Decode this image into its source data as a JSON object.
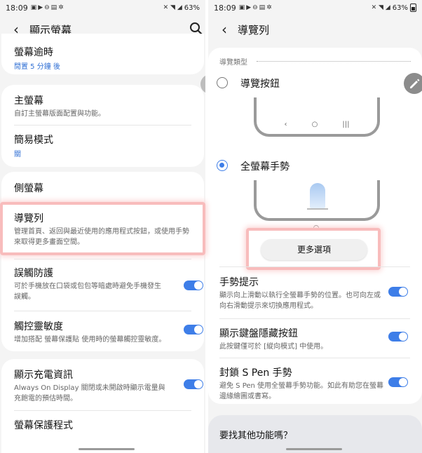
{
  "left": {
    "status": {
      "time": "18:09",
      "battery": "63%"
    },
    "title": "顯示螢幕",
    "items": {
      "screen_timeout": {
        "title": "螢幕逾時",
        "value": "閒置 5 分鐘 後"
      },
      "main_screen": {
        "title": "主螢幕",
        "desc": "自訂主螢幕版面配置與功能。"
      },
      "easy_mode": {
        "title": "簡易模式",
        "value": "關"
      },
      "edge_screen": {
        "title": "側螢幕"
      },
      "navigation_bar": {
        "title": "導覽列",
        "desc": "管理首頁、返回與最近使用的應用程式按鈕，或使用手勢來取得更多畫面空間。"
      },
      "accidental_touch": {
        "title": "誤觸防護",
        "desc": "可於手機放在口袋或包包等暗處時避免手機發生誤觸。",
        "enabled": true
      },
      "touch_sensitivity": {
        "title": "觸控靈敏度",
        "desc": "增加搭配 螢幕保護貼 使用時的螢幕觸控靈敏度。",
        "enabled": true
      },
      "charging_info": {
        "title": "顯示充電資訊",
        "desc": "Always On Display 關閉或未開啟時顯示電量與充飽電的預估時間。",
        "enabled": true
      },
      "screensaver": {
        "title": "螢幕保護程式"
      }
    }
  },
  "right": {
    "status": {
      "time": "18:09",
      "battery": "63%"
    },
    "title": "導覽列",
    "section_label": "導覽類型",
    "options": {
      "nav_buttons": {
        "label": "導覽按鈕",
        "selected": false
      },
      "full_gestures": {
        "label": "全螢幕手勢",
        "selected": true
      }
    },
    "nav_icons": [
      "‹",
      "○",
      "|||"
    ],
    "more_options": "更多選項",
    "items": {
      "gesture_hints": {
        "title": "手勢提示",
        "desc": "顯示向上滑動以執行全螢幕手勢的位置。也可向左或向右滑動提示來切換應用程式。",
        "enabled": true
      },
      "keyboard_hide_button": {
        "title": "顯示鍵盤隱藏按鈕",
        "desc": "此按鍵僅可於 [縱向模式] 中使用。",
        "enabled": true
      },
      "block_spen": {
        "title": "封鎖 S Pen 手勢",
        "desc": "避免 S Pen 使用全螢幕手勢功能。如此有助您在螢幕邊緣繪圖或書寫。",
        "enabled": true
      }
    },
    "looking_for": "要找其他功能嗎？"
  },
  "colors": {
    "accent": "#3e7ee8",
    "highlight": "#f8bcbc",
    "bg": "#f4f4f4"
  }
}
